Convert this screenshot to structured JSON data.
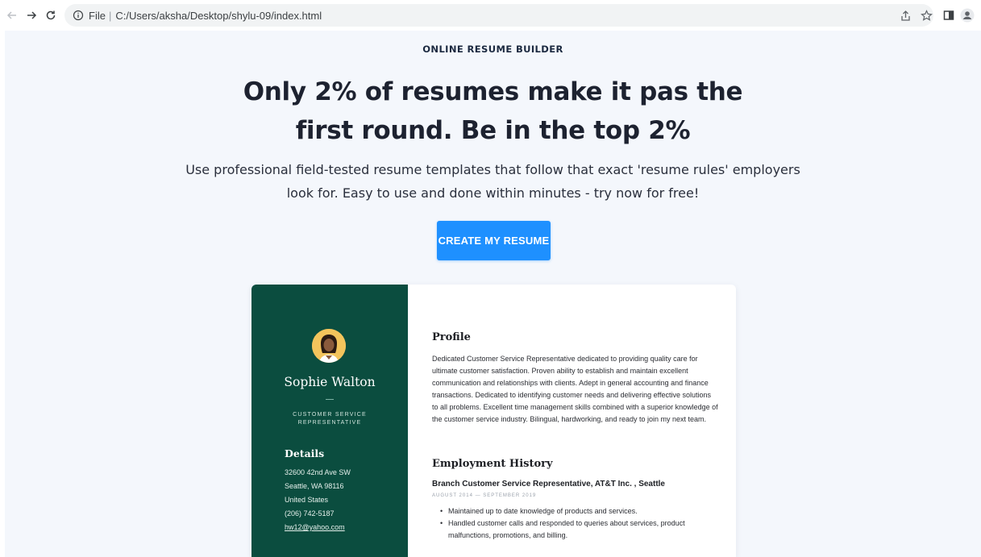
{
  "browser": {
    "address_label": "File",
    "address_url": "C:/Users/aksha/Desktop/shylu-09/index.html"
  },
  "hero": {
    "eyebrow": "ONLINE RESUME BUILDER",
    "headline": "Only 2% of resumes make it pas the first round. Be in the top 2%",
    "subhead": "Use professional field-tested resume templates that follow that exact 'resume rules' employers look for. Easy to use and done within minutes - try now for free!",
    "cta_label": "CREATE MY RESUME"
  },
  "resume": {
    "name": "Sophie Walton",
    "title": "CUSTOMER SERVICE REPRESENTATIVE",
    "details_heading": "Details",
    "details": {
      "address1": "32600 42nd Ave SW",
      "address2": "Seattle, WA 98116",
      "country": "United States",
      "phone": "(206) 742-5187",
      "email": "hw12@yahoo.com"
    },
    "profile_heading": "Profile",
    "profile_text": "Dedicated Customer Service Representative dedicated to providing quality care for ultimate customer satisfaction. Proven ability to establish and maintain excellent communication and relationships with clients. Adept in general accounting and finance transactions. Dedicated to identifying customer needs and delivering effective solutions to all problems. Excellent time management skills combined with a superior knowledge of the customer service industry. Bilingual, hardworking, and ready to join my next team.",
    "employment_heading": "Employment History",
    "job_title": "Branch Customer Service Representative, AT&T Inc. , Seattle",
    "job_dates": "AUGUST 2014 — SEPTEMBER 2019",
    "job_bullets": [
      "Maintained up to date knowledge of products and services.",
      "Handled customer calls and responded to queries about services, product malfunctions, promotions, and billing."
    ]
  },
  "colors": {
    "page_bg": "#f4f7fc",
    "cta_bg": "#1e90ff",
    "resume_sidebar": "#0b4d3f"
  },
  "icons": [
    "back-arrow-icon",
    "forward-arrow-icon",
    "reload-icon",
    "info-icon",
    "share-icon",
    "star-icon",
    "side-panel-icon",
    "profile-icon"
  ]
}
